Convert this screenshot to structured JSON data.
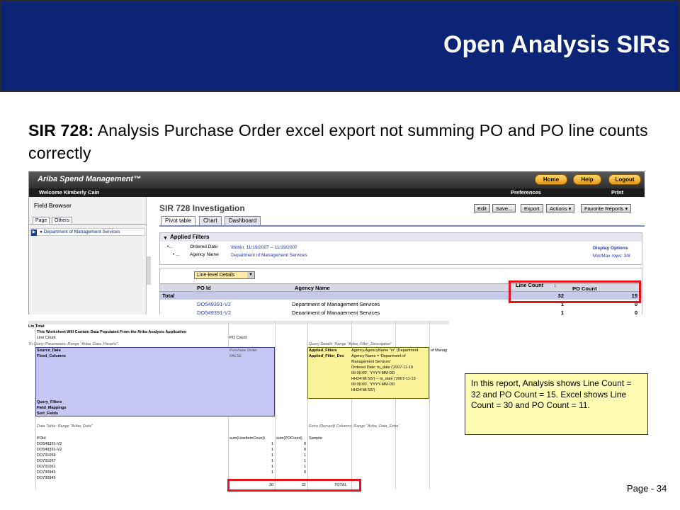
{
  "slide": {
    "title": "Open Analysis SIRs",
    "subtitle_bold": "SIR 728:",
    "subtitle_rest": " Analysis Purchase Order excel export not summing PO and PO line counts correctly",
    "page": "Page - 34"
  },
  "ariba": {
    "logo": "Ariba  Spend Management™",
    "buttons": [
      "Home",
      "Help",
      "Logout"
    ],
    "welcome": "Welcome Kimberly Cain",
    "preferences": "Preferences",
    "print": "Print",
    "field_browser": "Field Browser",
    "fb_tabs": [
      "Page",
      "Others"
    ],
    "fb_item": "● Department of Management Services",
    "report_title": "SIR 728 Investigation",
    "toolbar": [
      "Edit",
      "Save...",
      "Export",
      "Actions ▾",
      "Favorite Reports ▾"
    ],
    "view_tabs": [
      "Pivot table",
      "Chart",
      "Dashboard"
    ],
    "applied_filters": "Applied Filters",
    "filters": [
      {
        "bullet": "•...",
        "name": "Ordered Date",
        "value": "Within: 11/19/2007 -- 11/19/2007"
      },
      {
        "bullet": "• ...",
        "name": "Agency Name",
        "value": "Department of Management Services"
      }
    ],
    "display_options": "Display Options",
    "minmax": "Min/Max rows: 3/8",
    "line_level": "Line-level Details",
    "columns": {
      "po_id": "PO Id",
      "agency": "Agency Name",
      "line_count": "Line Count",
      "po_count": "PO Count",
      "sort": "↓"
    },
    "total_label": "Total",
    "total_line": "32",
    "total_po": "15",
    "rows": [
      {
        "po": "DO549391-V2",
        "agency": "Department of Management Services",
        "line": "1",
        "count": "0"
      },
      {
        "po": "DO549391-V2",
        "agency": "Department of Management Services",
        "line": "1",
        "count": "0"
      }
    ]
  },
  "excel": {
    "r1": "Lin Total",
    "r2": "This Worksheet Will Contain Data Populated From the Ariba Analysis Application",
    "r3a": "Line Count",
    "r3b": "PO Count",
    "qp": "To Query Parameters: Range \"Ariba_Data_Params\"",
    "qd": "Query Details: Range \"Ariba_Filter_Description\"",
    "source_data": "Source_Data",
    "source_val": "Purchase Order",
    "fixed_columns": "Fixed_Columns",
    "fixed_val": "FALSE",
    "applied_filters": "Applied_Filters",
    "applied_filters_val": "Agency.AgencyName \"in\" (Department",
    "applied_filters_overflow": "of Manag",
    "applied_filter_des": "Applied_Filter_Des",
    "filter_desc_lines": [
      "Agency Name = 'Department of",
      "Management Services'",
      "Ordered Date: to_date ('2007-11-19",
      "00:00:00', 'YYYY-MM-DD",
      "HH24:MI:SS') -- to_date ('2007-11-19",
      "00:00:00', 'YYYY-MM-DD",
      "HH24:MI:SS')"
    ],
    "query_filters": "Query_Filters",
    "field_mappings": "Field_Mappings",
    "sort_fields": "Sort_Fields",
    "data_table": "Data Table: Range \"Ariba_Data\"",
    "extra": "Extra (Derived) Columns: Range \"Ariba_Data_Extra\"",
    "headers": [
      "POId",
      "sum(LineItemCount)",
      "sum(POCount)",
      "Sample"
    ],
    "rows": [
      [
        "DO549391-V2",
        "1",
        "0"
      ],
      [
        "DO549391-V2",
        "1",
        "0"
      ],
      [
        "DO731059",
        "1",
        "1"
      ],
      [
        "DO731057",
        "1",
        "1"
      ],
      [
        "DO731061",
        "1",
        "1"
      ],
      [
        "DO730945",
        "1",
        "0"
      ],
      [
        "DO730945",
        "",
        ""
      ]
    ],
    "total_line": "30",
    "total_po": "11",
    "total_label": "TOTAL"
  },
  "note": "In this report, Analysis shows Line Count = 32 and PO Count = 15. Excel shows Line Count = 30 and PO Count = 11.",
  "colors": {
    "header": "#0b2475",
    "highlight": "#e3141b",
    "note_bg": "#fffdb4"
  }
}
